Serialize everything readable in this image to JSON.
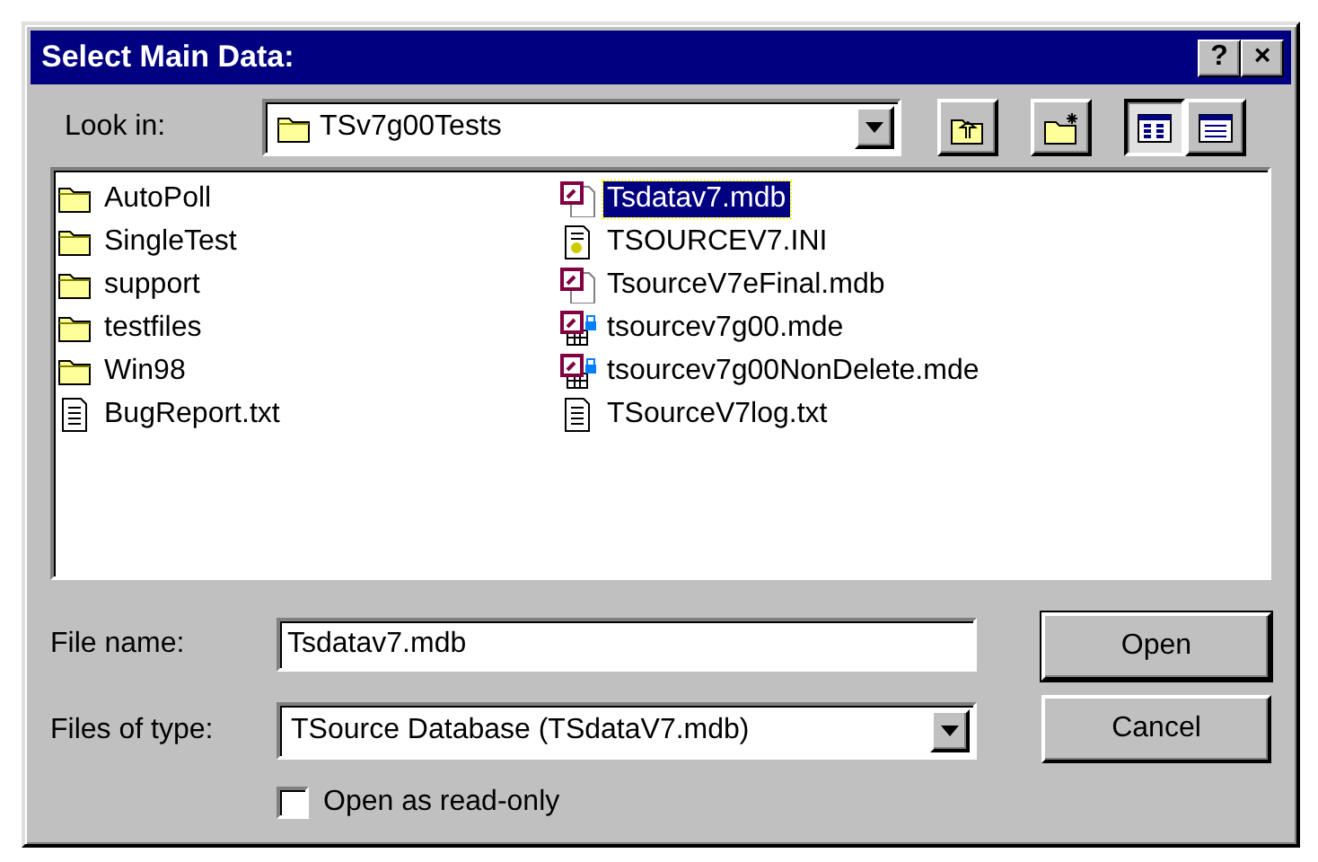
{
  "window": {
    "title": "Select Main Data:",
    "title_buttons": [
      "?",
      "×"
    ]
  },
  "look_in": {
    "label": "Look in:",
    "value": "TSv7g00Tests"
  },
  "toolbar": [
    {
      "kind": "up",
      "selected": false
    },
    {
      "kind": "newfolder",
      "selected": false
    },
    {
      "kind": "list",
      "selected": true
    },
    {
      "kind": "details",
      "selected": false
    }
  ],
  "files": [
    {
      "name": "AutoPoll",
      "kind": "folder",
      "selected": false
    },
    {
      "name": "SingleTest",
      "kind": "folder",
      "selected": false
    },
    {
      "name": "support",
      "kind": "folder",
      "selected": false
    },
    {
      "name": "testfiles",
      "kind": "folder",
      "selected": false
    },
    {
      "name": "Win98",
      "kind": "folder",
      "selected": false
    },
    {
      "name": "BugReport.txt",
      "kind": "text",
      "selected": false
    },
    {
      "name": "Tsdatav7.mdb",
      "kind": "mdb",
      "selected": true
    },
    {
      "name": "TSOURCEV7.INI",
      "kind": "ini",
      "selected": false
    },
    {
      "name": "TsourceV7eFinal.mdb",
      "kind": "mdb",
      "selected": false
    },
    {
      "name": "tsourcev7g00.mde",
      "kind": "mde",
      "selected": false
    },
    {
      "name": "tsourcev7g00NonDelete.mde",
      "kind": "mde",
      "selected": false
    },
    {
      "name": "TSourceV7log.txt",
      "kind": "text",
      "selected": false
    }
  ],
  "file_name": {
    "label": "File name:",
    "value": "Tsdatav7.mdb"
  },
  "file_type": {
    "label": "Files of type:",
    "value": "TSource Database (TSdataV7.mdb)"
  },
  "read_only": {
    "label": "Open as read-only",
    "checked": false
  },
  "buttons": [
    {
      "label": "Open",
      "default": true
    },
    {
      "label": "Cancel",
      "default": false
    }
  ]
}
